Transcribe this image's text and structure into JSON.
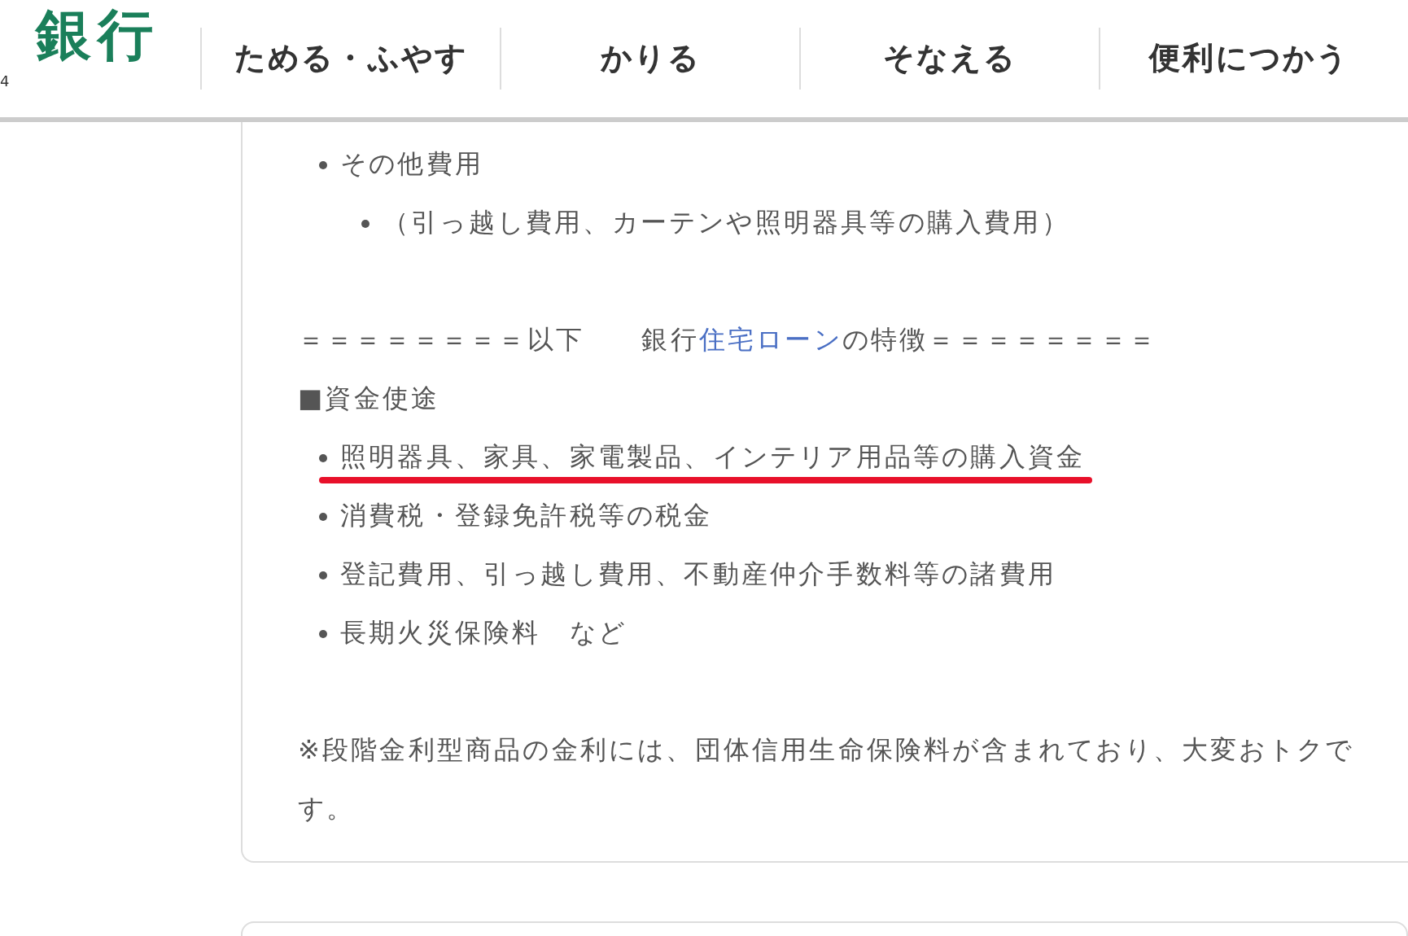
{
  "header": {
    "logo": "銀行",
    "logo_sub": "4",
    "nav": [
      {
        "label": "ためる・ふやす"
      },
      {
        "label": "かりる"
      },
      {
        "label": "そなえる"
      },
      {
        "label": "便利につかう"
      }
    ]
  },
  "top_list": [
    {
      "text": "その他費用",
      "children": [
        {
          "text": "（引っ越し費用、カーテンや照明器具等の購入費用）"
        }
      ]
    }
  ],
  "feature_line": {
    "before": "＝＝＝＝＝＝＝＝以下　　銀行",
    "link": "住宅ローン",
    "after": "の特徴＝＝＝＝＝＝＝＝"
  },
  "section_label": "■資金使途",
  "uses": [
    {
      "text": "照明器具、家具、家電製品、インテリア用品等の購入資金",
      "underlined": true
    },
    {
      "text": "消費税・登録免許税等の税金",
      "underlined": false
    },
    {
      "text": "登記費用、引っ越し費用、不動産仲介手数料等の諸費用",
      "underlined": false
    },
    {
      "text": "長期火災保険料　など",
      "underlined": false
    }
  ],
  "note": "※段階金利型商品の金利には、団体信用生命保険料が含まれており、大変おトクです。"
}
